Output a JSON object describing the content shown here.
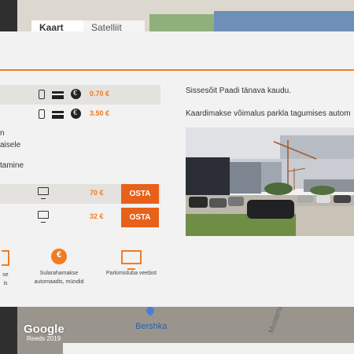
{
  "map": {
    "tabs": [
      {
        "label": "Kaart"
      },
      {
        "label": "Satelliit"
      }
    ],
    "google_logo": "Google",
    "google_sub": "Reeds 2019",
    "place_label": "Bershka",
    "street_label": "Mustamäe"
  },
  "prices": [
    {
      "price": "0.70 €",
      "icons": [
        "phone-icon",
        "card-icon",
        "coin-icon"
      ]
    },
    {
      "price": "3.50 €",
      "icons": [
        "phone-icon",
        "card-icon",
        "coin-icon"
      ]
    }
  ],
  "text_lines": [
    {
      "text": "n"
    },
    {
      "text": "aisele"
    },
    {
      "text": "tamine"
    }
  ],
  "buy_rows": [
    {
      "price": "70 €",
      "button": "OSTA"
    },
    {
      "price": "32 €",
      "button": "OSTA"
    }
  ],
  "payment_methods": [
    {
      "icon": "partial-icon",
      "line1": "se",
      "line2": "is"
    },
    {
      "icon": "cash-icon",
      "line1": "Sularahamakse",
      "line2": "automaadis, mündid"
    },
    {
      "icon": "online-icon",
      "line1": "Parkimisluba veebist",
      "line2": ""
    }
  ],
  "info": {
    "entrance": "Sissesõit Paadi tänava kaudu.",
    "card_payment": "Kaardimakse võimalus parkla tagumises autom"
  },
  "colors": {
    "accent": "#f07b22",
    "button": "#e8611a"
  }
}
